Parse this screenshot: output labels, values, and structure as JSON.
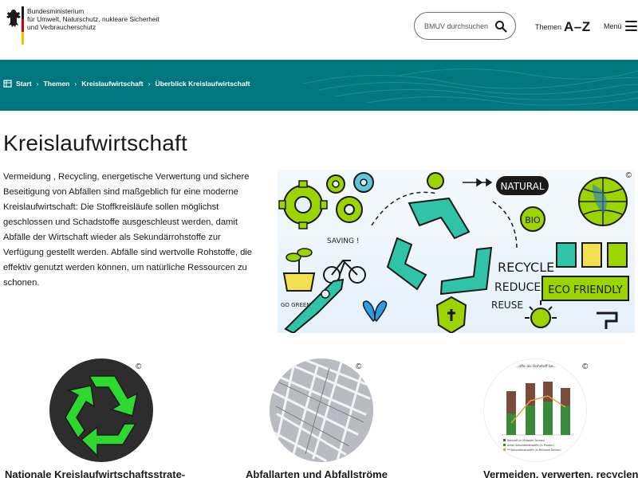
{
  "header": {
    "ministry_lines": [
      "Bundesministerium",
      "für Umwelt, Naturschutz, nukleare Sicherheit",
      "und Verbraucherschutz"
    ],
    "search_placeholder": "BMUV durchsuchen",
    "themen_label": "Themen",
    "themen_az": "A–Z",
    "menu_label": "Menü"
  },
  "breadcrumb": [
    "Start",
    "Themen",
    "Kreislaufwirtschaft",
    "Überblick Kreislaufwirtschaft"
  ],
  "page": {
    "title": "Kreislaufwirtschaft",
    "intro": "Vermeidung , Recycling,  energetische Verwertung  und sichere Beseitigung von Abfällen sind maßgeblich für eine moderne Kreislaufwirtschaft: Die Stoffkreisläufe sollen möglichst geschlossen und Schadstoffe ausgeschleust werden, damit Abfälle der Wirtschaft wieder als Sekundärrohstoffe zur Verfügung gestellt werden. Abfälle sind wertvolle Rohstoffe, die effektiv genutzt werden können, um natürliche Ressourcen zu schonen."
  },
  "hero": {
    "copyright": "©",
    "doodle_texts": [
      "NATURAL",
      "BIO",
      "SAVING !",
      "RECYCLE",
      "REDUCE",
      "REUSE",
      "ECO FRIENDLY",
      "GO GREEN"
    ]
  },
  "cards": [
    {
      "title": "Nationale Kreislaufwirtschaftsstrate-",
      "copyright": "©",
      "icon": "recycle-icon"
    },
    {
      "title": "Abfallarten und Abfallströme",
      "copyright": "©",
      "icon": "shredded-paper-image"
    },
    {
      "title": "Vermeiden, verwerten, recyclen",
      "copyright": "©",
      "icon": "bar-chart-thumbnail"
    }
  ],
  "chart_thumb": {
    "title": "...offe als Rohstoff be...",
    "legend": [
      "Rohstoff (in Millionen Tonnen)",
      "Anteil Sekundärrohstoffe (in Prozent)",
      "** Sekundärrohstoffe (in Millionen Tonnen)"
    ]
  },
  "colors": {
    "teal": "#00777f",
    "recycle_green": "#2ecc40",
    "bar_brown": "#7a4a3a",
    "bar_green": "#3a8a3a",
    "line_orange": "#e8a040"
  }
}
